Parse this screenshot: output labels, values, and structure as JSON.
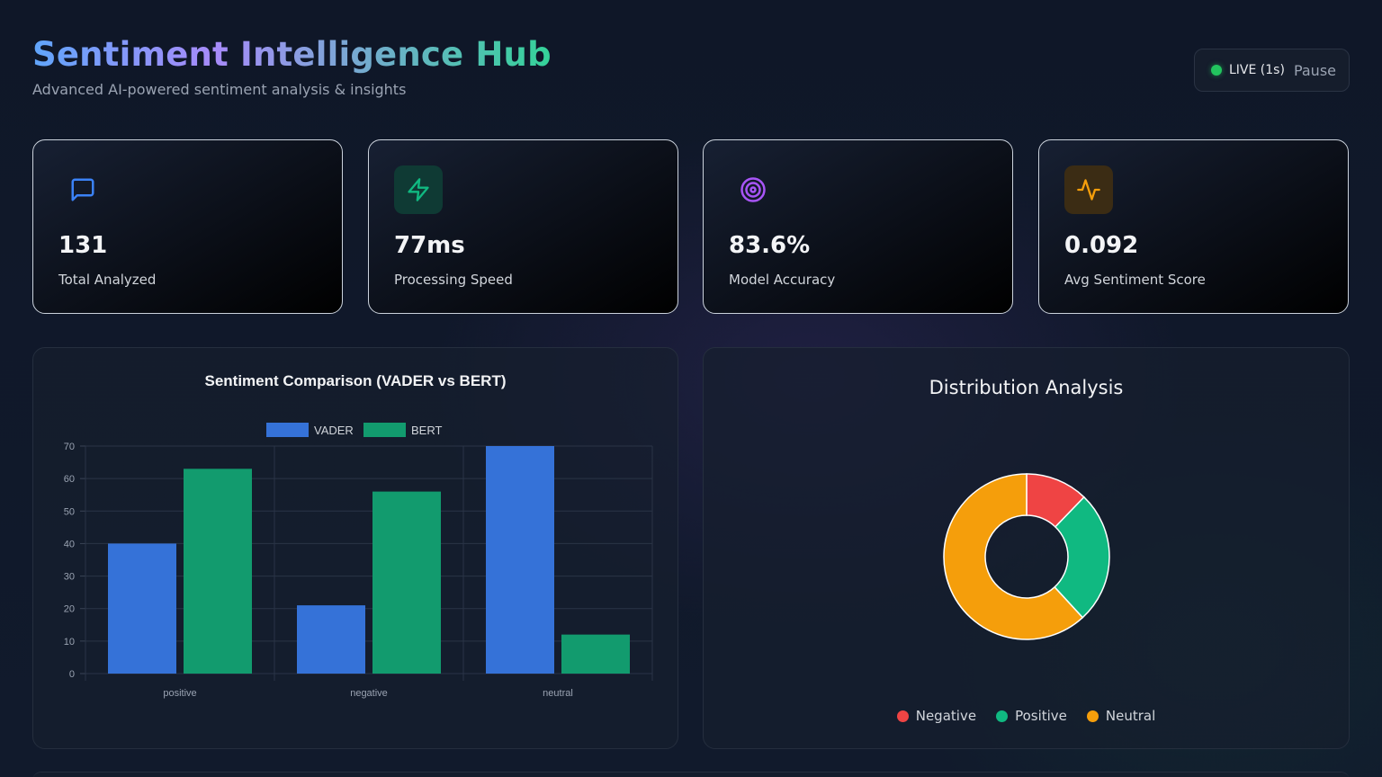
{
  "header": {
    "title": "Sentiment Intelligence Hub",
    "subtitle": "Advanced AI-powered sentiment analysis & insights"
  },
  "live": {
    "status": "LIVE (1s)",
    "pause_label": "Pause",
    "color": "#22c55e"
  },
  "stats": [
    {
      "value": "131",
      "label": "Total Analyzed",
      "icon": "message-icon",
      "accent": "#3b82f6"
    },
    {
      "value": "77ms",
      "label": "Processing Speed",
      "icon": "lightning-icon",
      "accent": "#10b981"
    },
    {
      "value": "83.6%",
      "label": "Model Accuracy",
      "icon": "target-icon",
      "accent": "#a855f7"
    },
    {
      "value": "0.092",
      "label": "Avg Sentiment Score",
      "icon": "activity-icon",
      "accent": "#f59e0b"
    }
  ],
  "bar_panel": {
    "title": "Sentiment Comparison (VADER vs BERT)"
  },
  "donut_panel": {
    "title": "Distribution Analysis"
  },
  "chart_data": [
    {
      "type": "bar",
      "title": "Sentiment Comparison (VADER vs BERT)",
      "categories": [
        "positive",
        "negative",
        "neutral"
      ],
      "series": [
        {
          "name": "VADER",
          "values": [
            40,
            21,
            70
          ],
          "color": "#3572d8"
        },
        {
          "name": "BERT",
          "values": [
            63,
            56,
            12
          ],
          "color": "#129b6e"
        }
      ],
      "ylim": [
        0,
        70
      ],
      "yticks": [
        0,
        10,
        20,
        30,
        40,
        50,
        60,
        70
      ],
      "legend": "top",
      "grid": true
    },
    {
      "type": "pie",
      "title": "Distribution Analysis",
      "labels": [
        "Negative",
        "Positive",
        "Neutral"
      ],
      "values": [
        16,
        34,
        81
      ],
      "colors": [
        "#ef4444",
        "#10b981",
        "#f59e0b"
      ],
      "legend": "bottom"
    }
  ]
}
